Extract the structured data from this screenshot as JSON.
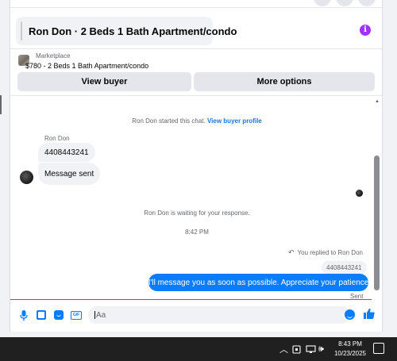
{
  "conversation": {
    "title": "Ron Don · 2 Beds 1 Bath Apartment/condo",
    "info_icon": "i"
  },
  "listing": {
    "source": "Marketplace",
    "summary": "$780 - 2 Beds 1 Bath Apartment/condo"
  },
  "actions": {
    "view_buyer": "View buyer",
    "more_options": "More options"
  },
  "messages": {
    "started_text": "Ron Don started this chat.",
    "started_link": "View buyer profile",
    "sender_name": "Ron Don",
    "incoming": [
      "4408443241",
      "Message sent"
    ],
    "waiting_text": "Ron Don is waiting for your response.",
    "timestamp": "8:42 PM",
    "replied_label": "You replied to Ron Don",
    "quoted_text": "4408443241",
    "outgoing": "I'll message you as soon as possible. Appreciate your patience",
    "status": "Sent"
  },
  "composer": {
    "placeholder": "Aa",
    "gif_label": "GIF"
  },
  "taskbar": {
    "time": "8:43 PM",
    "date": "10/23/2025"
  },
  "colors": {
    "accent": "#0a7cff",
    "info": "#a033ff"
  }
}
